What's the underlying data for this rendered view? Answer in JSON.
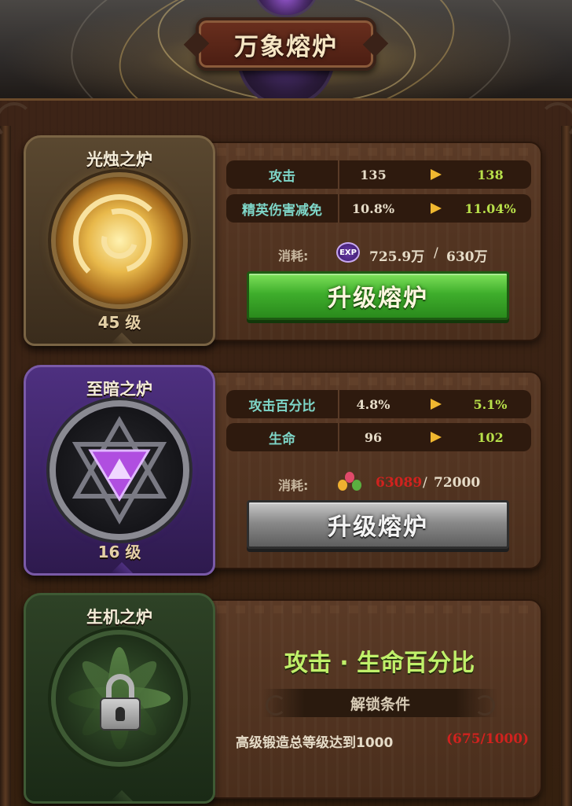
{
  "header": {
    "title": "万象熔炉"
  },
  "furnaces": [
    {
      "name": "光烛之炉",
      "level": "45 级",
      "stats": [
        {
          "name": "攻击",
          "current": "135",
          "next": "138"
        },
        {
          "name": "精英伤害减免",
          "current": "10.8%",
          "next": "11.04%"
        }
      ],
      "cost": {
        "label": "消耗:",
        "icon": "exp-icon",
        "icon_text": "EXP",
        "have": "725.9万",
        "separator": "/",
        "need": "630万",
        "have_color": "#e6dcc8"
      },
      "button": {
        "label": "升级熔炉",
        "state": "enabled",
        "color": "#3fae2c"
      }
    },
    {
      "name": "至暗之炉",
      "level": "16 级",
      "stats": [
        {
          "name": "攻击百分比",
          "current": "4.8%",
          "next": "5.1%"
        },
        {
          "name": "生命",
          "current": "96",
          "next": "102"
        }
      ],
      "cost": {
        "label": "消耗:",
        "icon": "flower-icon",
        "have": "63089",
        "separator": "/",
        "need": "72000",
        "have_color": "#d0221e"
      },
      "button": {
        "label": "升级熔炉",
        "state": "disabled",
        "color": "#8a8a8a"
      }
    },
    {
      "name": "生机之炉",
      "locked": true,
      "bonus": "攻击 · 生命百分比",
      "unlock": {
        "title": "解锁条件",
        "requirement": "高级锻造总等级达到1000",
        "progress": "(675/1000)"
      }
    }
  ],
  "colors": {
    "stat_name": "#7ed6c8",
    "stat_next": "#b8e04a",
    "arrow": "#f0b830",
    "insufficient": "#d0221e",
    "locked_bonus": "#c0f06a"
  }
}
